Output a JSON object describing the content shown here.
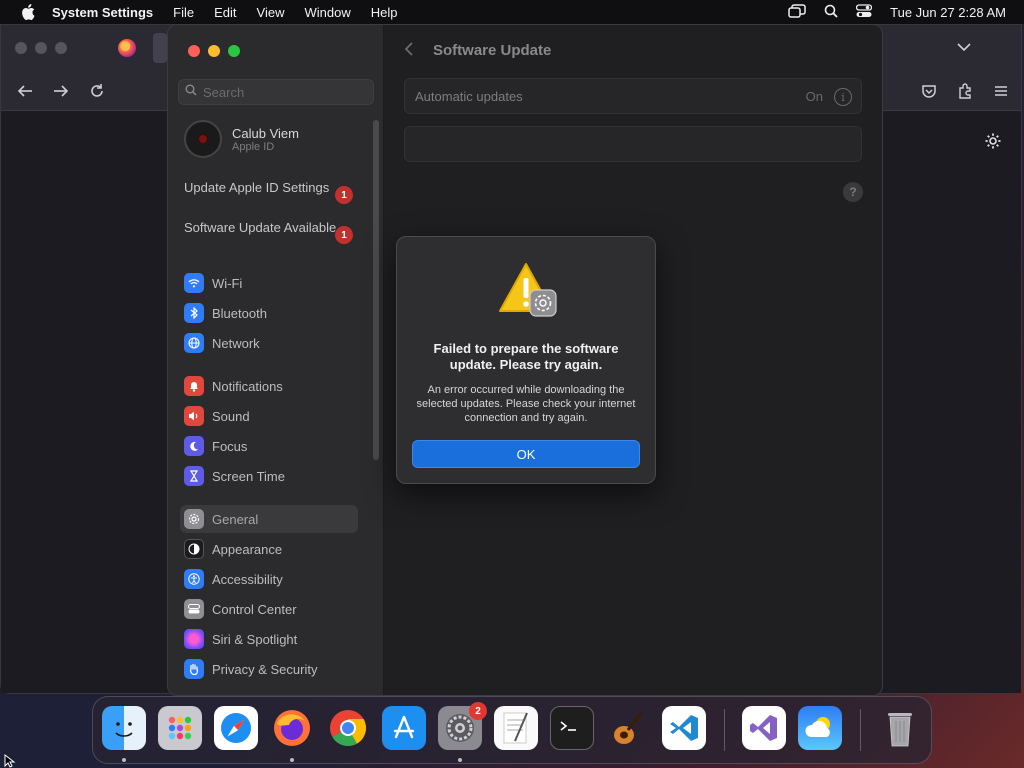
{
  "menubar": {
    "app_name": "System Settings",
    "items": [
      "File",
      "Edit",
      "View",
      "Window",
      "Help"
    ],
    "clock": "Tue Jun 27  2:28 AM"
  },
  "sidebar": {
    "search_placeholder": "Search",
    "profile": {
      "name": "Calub Viem",
      "sub": "Apple ID"
    },
    "notices": [
      {
        "label": "Update Apple ID Settings",
        "badge": "1"
      },
      {
        "label": "Software Update Available",
        "badge": "1"
      }
    ],
    "items": [
      {
        "label": "Wi-Fi",
        "icon": "wifi-icon",
        "color": "#2f7cf6"
      },
      {
        "label": "Bluetooth",
        "icon": "bluetooth-icon",
        "color": "#2f7cf6"
      },
      {
        "label": "Network",
        "icon": "globe-icon",
        "color": "#2f7cf6"
      },
      {
        "label": "Notifications",
        "icon": "bell-icon",
        "color": "#e0483e"
      },
      {
        "label": "Sound",
        "icon": "speaker-icon",
        "color": "#e0483e"
      },
      {
        "label": "Focus",
        "icon": "moon-icon",
        "color": "#5e5ce6"
      },
      {
        "label": "Screen Time",
        "icon": "hourglass-icon",
        "color": "#5e5ce6"
      },
      {
        "label": "General",
        "icon": "gear-icon",
        "color": "#8e8e93"
      },
      {
        "label": "Appearance",
        "icon": "appearance-icon",
        "color": "#1c1c1e"
      },
      {
        "label": "Accessibility",
        "icon": "accessibility-icon",
        "color": "#2f7cf6"
      },
      {
        "label": "Control Center",
        "icon": "control-center-icon",
        "color": "#8e8e93"
      },
      {
        "label": "Siri & Spotlight",
        "icon": "siri-icon",
        "color": "#b04ad6"
      },
      {
        "label": "Privacy & Security",
        "icon": "hand-icon",
        "color": "#2f7cf6"
      }
    ]
  },
  "pane": {
    "title": "Software Update",
    "auto_updates_label": "Automatic updates",
    "auto_updates_value": "On",
    "info_glyph": "i",
    "help_glyph": "?"
  },
  "dialog": {
    "title": "Failed to prepare the software update. Please try again.",
    "body": "An error occurred while downloading the selected updates. Please check your internet connection and try again.",
    "ok_label": "OK"
  },
  "dock": {
    "apps": [
      "Finder",
      "Launchpad",
      "Safari",
      "Firefox",
      "Chrome",
      "App Store",
      "System Settings",
      "TextEdit",
      "Terminal",
      "GarageBand",
      "VS Code",
      "Visual Studio",
      "Weather",
      "Trash"
    ],
    "settings_badge": "2"
  },
  "colors": {
    "accent": "#1b6fdc",
    "badge": "#c0302d",
    "close": "#ff5f57",
    "minimize": "#febc2e",
    "zoom": "#28c840"
  }
}
